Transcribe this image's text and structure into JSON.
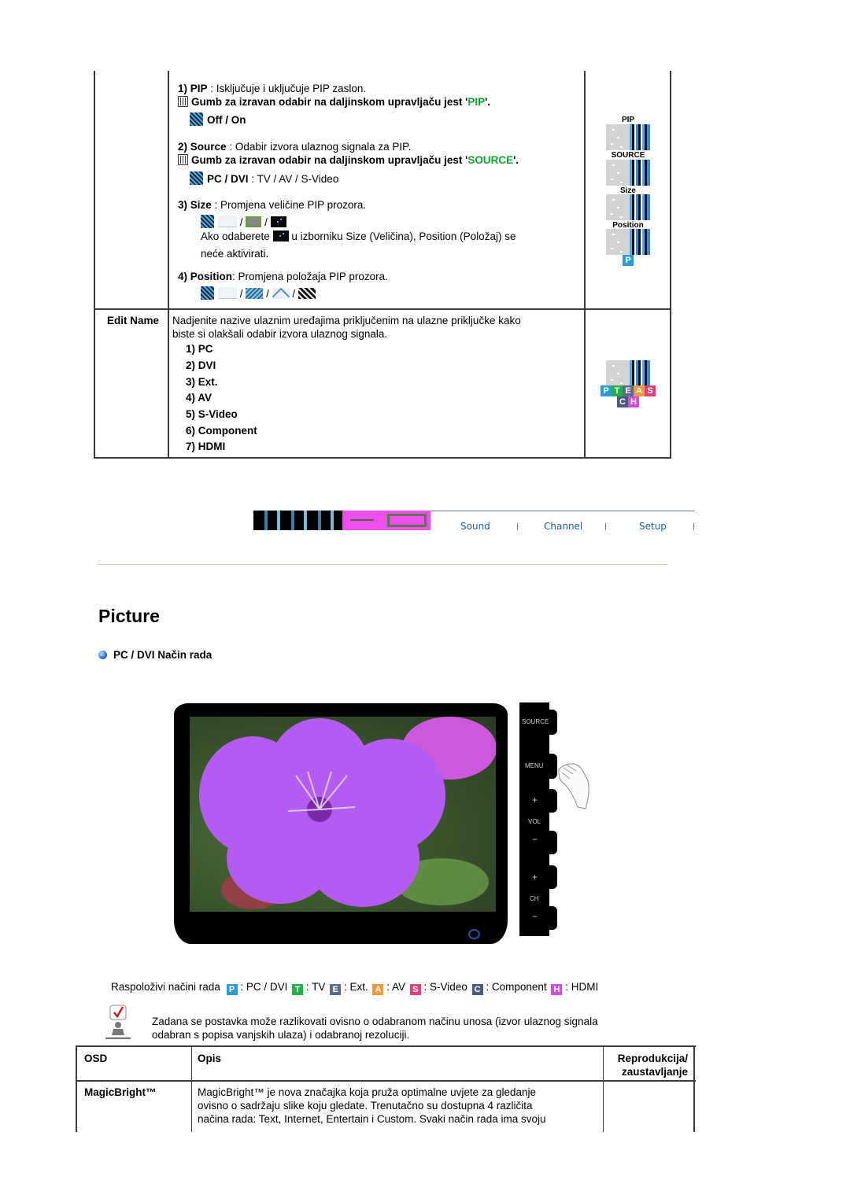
{
  "pip_section": {
    "items": [
      {
        "num": "1)",
        "label": "PIP",
        "desc": " : Isključuje i uključuje PIP zaslon.",
        "remote_prefix": "Gumb za izravan odabir na daljinskom upravljaču jest '",
        "remote_key": "PIP",
        "remote_suffix": "'.",
        "options_label": "Off / On"
      },
      {
        "num": "2)",
        "label": "Source",
        "desc": " : Odabir izvora ulaznog signala za PIP.",
        "remote_prefix": "Gumb za izravan odabir na daljinskom upravljaču jest '",
        "remote_key": "SOURCE",
        "remote_suffix": "'.",
        "options_bold": "PC / DVI",
        "options_rest": " : TV / AV / S-Video"
      },
      {
        "num": "3)",
        "label": "Size",
        "desc": " : Promjena veličine PIP prozora.",
        "note_before": "Ako odaberete ",
        "note_after": " u izborniku Size (Veličina), Position (Položaj) se",
        "note_line2": "neće aktivirati."
      },
      {
        "num": "4)",
        "label": "Position",
        "desc": ": Promjena položaja PIP prozora."
      }
    ],
    "separator": "/",
    "side_labels": [
      "PIP",
      "SOURCE",
      "Size",
      "Position"
    ],
    "side_badge": "P"
  },
  "edit_name": {
    "label": "Edit Name",
    "desc_line1": "Nadjenite nazive ulaznim uređajima priključenim na ulazne priključke kako",
    "desc_line2": "biste si olakšali odabir izvora ulaznog signala.",
    "list": [
      "1) PC",
      "2) DVI",
      "3) Ext.",
      "4) AV",
      "5) S-Video",
      "6) Component",
      "7) HDMI"
    ],
    "badges_row1": [
      "P",
      "T",
      "E",
      "A",
      "S"
    ],
    "badges_row2": [
      "C",
      "H"
    ]
  },
  "nav": {
    "tabs": [
      "Sound",
      "Channel",
      "Setup"
    ]
  },
  "picture": {
    "title": "Picture",
    "mode_heading": "PC / DVI Način rada",
    "monitor_buttons": [
      "SOURCE",
      "MENU",
      "+",
      "VOL",
      "−",
      "+",
      "CH",
      "−"
    ],
    "modes_intro": "Raspoloživi načini rada",
    "modes": [
      {
        "badge": "P",
        "label": ": PC / DVI",
        "color": "#2a9bd3"
      },
      {
        "badge": "T",
        "label": ": TV",
        "color": "#22b04a"
      },
      {
        "badge": "E",
        "label": ": Ext.",
        "color": "#5a6a8a"
      },
      {
        "badge": "A",
        "label": ": AV",
        "color": "#f59a3a"
      },
      {
        "badge": "S",
        "label": ": S-Video",
        "color": "#e0407a"
      },
      {
        "badge": "C",
        "label": ": Component",
        "color": "#4a5a7a"
      },
      {
        "badge": "H",
        "label": ": HDMI",
        "color": "#d24ee0"
      }
    ],
    "note_line1": "Zadana se postavka može razlikovati ovisno o odabranom načinu unosa (izvor ulaznog signala",
    "note_line2": "odabran s popisa vanjskih ulaza) i odabranoj rezoluciji."
  },
  "osd_table": {
    "headers": [
      "OSD",
      "Opis",
      "Reprodukcija/",
      "zaustavljanje"
    ],
    "row": {
      "name": "MagicBright™",
      "desc": [
        "MagicBright™ je nova značajka koja pruža optimalne uvjete za gledanje",
        "ovisno o sadržaju slike koju gledate. Trenutačno su dostupna 4 različita",
        "načina rada: Text, Internet, Entertain i Custom. Svaki način rada ima svoju"
      ]
    }
  },
  "colors": {
    "remote_key": "#16a232",
    "nav_tab": "#1f5f8b",
    "divider": "#c9c8a8",
    "badge_blue": "#2a9bd3"
  }
}
